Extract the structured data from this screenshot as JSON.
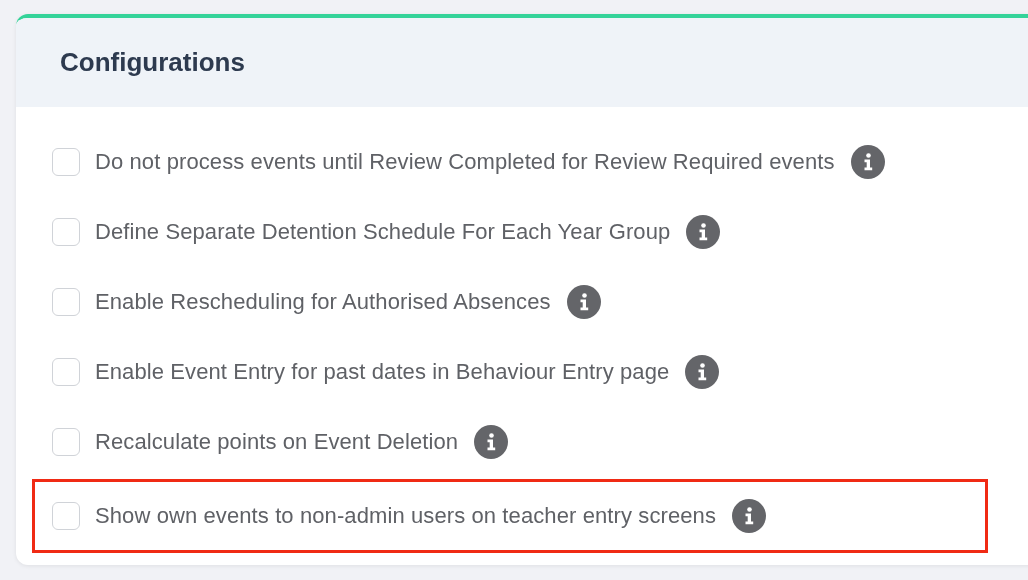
{
  "card": {
    "title": "Configurations"
  },
  "options": [
    {
      "label": "Do not process events until Review Completed for Review Required events",
      "checked": false,
      "highlighted": false
    },
    {
      "label": "Define Separate Detention Schedule For Each Year Group",
      "checked": false,
      "highlighted": false
    },
    {
      "label": "Enable Rescheduling for Authorised Absences",
      "checked": false,
      "highlighted": false
    },
    {
      "label": "Enable Event Entry for past dates in Behaviour Entry page",
      "checked": false,
      "highlighted": false
    },
    {
      "label": "Recalculate points on Event Deletion",
      "checked": false,
      "highlighted": false
    },
    {
      "label": "Show own events to non-admin users on teacher entry screens",
      "checked": false,
      "highlighted": true
    }
  ]
}
